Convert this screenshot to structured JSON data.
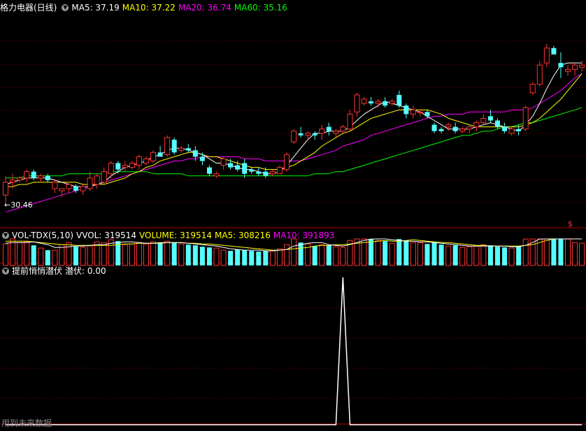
{
  "colors": {
    "background": "#000000",
    "grid": "#8b0000",
    "axis": "#b00000",
    "up": "#ff3232",
    "down": "#54ffff",
    "ma5": "#ffffff",
    "ma10": "#ffff00",
    "ma20": "#ff00ff",
    "ma60": "#00ff00",
    "vol_ma5": "#ffffff",
    "vol_ma10": "#ffff00",
    "signal": "#ffffff"
  },
  "price_panel": {
    "title": "格力电器(日线)",
    "toggle_icon": "chevron-down-icon",
    "legend": [
      {
        "label": "MA5: 37.19",
        "color": "#ffffff"
      },
      {
        "label": "MA10: 37.22",
        "color": "#ffff00"
      },
      {
        "label": "MA20: 36.74",
        "color": "#ff00ff"
      },
      {
        "label": "MA60: 35.16",
        "color": "#00ff00"
      }
    ],
    "low_marker": "30.46",
    "corner_marker": "$"
  },
  "volume_panel": {
    "title": "VOL-TDX(5,10)",
    "toggle_icon": "chevron-down-icon",
    "legend": [
      {
        "label": "VVOL: 319514",
        "color": "#ffffff"
      },
      {
        "label": "VOLUME: 319514",
        "color": "#ffff00"
      },
      {
        "label": "MA5: 308216",
        "color": "#ffff00"
      },
      {
        "label": "MA10: 391893",
        "color": "#ff00ff"
      }
    ]
  },
  "signal_panel": {
    "title": "提前悄悄潜伏",
    "toggle_icon": "chevron-down-icon",
    "legend": [
      {
        "label": "潜伏: 0.00",
        "color": "#ffffff"
      }
    ]
  },
  "footer_note": "用到未来数据",
  "chart_data": [
    {
      "type": "candlestick",
      "ylim": [
        29.5,
        39.5
      ],
      "candles": [
        [
          31.0,
          31.9,
          30.5,
          31.6
        ],
        [
          31.6,
          32.0,
          31.3,
          31.7
        ],
        [
          31.7,
          31.9,
          31.6,
          31.8
        ],
        [
          31.8,
          32.2,
          31.6,
          32.1
        ],
        [
          32.1,
          32.2,
          31.7,
          31.8
        ],
        [
          31.8,
          32.0,
          31.6,
          31.9
        ],
        [
          31.9,
          32.0,
          31.6,
          31.7
        ],
        [
          31.3,
          31.7,
          31.1,
          31.6
        ],
        [
          31.2,
          31.3,
          30.9,
          31.3
        ],
        [
          31.3,
          31.6,
          31.1,
          31.5
        ],
        [
          31.4,
          31.5,
          31.1,
          31.2
        ],
        [
          31.2,
          31.5,
          31.0,
          31.4
        ],
        [
          31.3,
          32.1,
          31.2,
          31.8
        ],
        [
          31.5,
          32.0,
          31.3,
          31.9
        ],
        [
          31.6,
          32.3,
          31.5,
          32.1
        ],
        [
          32.0,
          32.6,
          31.8,
          32.5
        ],
        [
          32.5,
          32.6,
          32.0,
          32.2
        ],
        [
          32.3,
          32.6,
          32.1,
          32.4
        ],
        [
          32.3,
          32.6,
          32.2,
          32.5
        ],
        [
          32.4,
          32.9,
          32.2,
          32.8
        ],
        [
          32.5,
          32.8,
          32.4,
          32.7
        ],
        [
          32.6,
          33.1,
          32.5,
          33.0
        ],
        [
          33.0,
          33.3,
          32.9,
          32.8
        ],
        [
          32.9,
          33.8,
          32.8,
          33.7
        ],
        [
          33.6,
          33.7,
          32.9,
          33.0
        ],
        [
          33.1,
          33.3,
          33.0,
          33.2
        ],
        [
          33.2,
          33.4,
          33.0,
          33.1
        ],
        [
          33.1,
          33.3,
          32.6,
          32.8
        ],
        [
          32.8,
          33.0,
          32.4,
          32.6
        ],
        [
          32.3,
          32.4,
          31.9,
          32.0
        ],
        [
          31.9,
          32.1,
          31.8,
          32.0
        ],
        [
          32.4,
          32.8,
          32.2,
          32.7
        ],
        [
          32.5,
          32.7,
          32.2,
          32.3
        ],
        [
          32.4,
          32.6,
          32.1,
          32.2
        ],
        [
          32.5,
          32.7,
          31.8,
          32.0
        ],
        [
          32.2,
          32.3,
          32.0,
          32.1
        ],
        [
          32.1,
          32.3,
          31.9,
          32.0
        ],
        [
          32.1,
          32.3,
          31.8,
          31.9
        ],
        [
          32.0,
          32.2,
          31.9,
          32.1
        ],
        [
          32.0,
          32.4,
          32.0,
          32.3
        ],
        [
          32.2,
          33.0,
          32.1,
          32.9
        ],
        [
          33.5,
          34.1,
          33.4,
          34.0
        ],
        [
          33.9,
          34.2,
          33.7,
          33.8
        ],
        [
          33.8,
          34.0,
          33.6,
          33.9
        ],
        [
          33.9,
          34.0,
          33.6,
          33.8
        ],
        [
          33.9,
          34.3,
          33.6,
          34.1
        ],
        [
          34.2,
          34.4,
          33.8,
          34.0
        ],
        [
          33.9,
          34.1,
          33.7,
          34.0
        ],
        [
          34.0,
          34.3,
          33.9,
          34.2
        ],
        [
          34.1,
          35.0,
          34.0,
          34.8
        ],
        [
          34.9,
          35.8,
          34.7,
          35.7
        ],
        [
          35.3,
          35.6,
          35.2,
          35.5
        ],
        [
          35.4,
          35.6,
          35.2,
          35.3
        ],
        [
          35.3,
          35.5,
          35.1,
          35.4
        ],
        [
          35.4,
          35.6,
          35.1,
          35.2
        ],
        [
          35.3,
          35.5,
          35.2,
          35.4
        ],
        [
          35.7,
          35.9,
          35.1,
          35.2
        ],
        [
          35.2,
          35.3,
          34.6,
          34.8
        ],
        [
          34.8,
          35.2,
          34.6,
          35.0
        ],
        [
          34.9,
          35.0,
          34.7,
          34.9
        ],
        [
          34.9,
          35.0,
          34.6,
          34.7
        ],
        [
          34.3,
          34.4,
          33.9,
          34.0
        ],
        [
          34.1,
          34.2,
          33.9,
          34.0
        ],
        [
          34.2,
          34.4,
          34.0,
          34.3
        ],
        [
          34.2,
          34.4,
          33.9,
          34.0
        ],
        [
          34.0,
          34.2,
          33.9,
          34.1
        ],
        [
          34.1,
          34.3,
          33.9,
          34.2
        ],
        [
          34.2,
          34.5,
          34.0,
          34.4
        ],
        [
          34.4,
          34.8,
          34.3,
          34.6
        ],
        [
          34.7,
          35.0,
          34.4,
          34.5
        ],
        [
          34.5,
          34.6,
          34.1,
          34.2
        ],
        [
          34.2,
          34.4,
          33.9,
          34.0
        ],
        [
          33.9,
          34.2,
          33.8,
          34.1
        ],
        [
          34.1,
          34.3,
          33.8,
          34.0
        ],
        [
          34.1,
          35.2,
          34.0,
          35.1
        ],
        [
          35.8,
          36.3,
          35.7,
          36.2
        ],
        [
          36.2,
          37.3,
          36.1,
          37.1
        ],
        [
          37.2,
          38.1,
          37.0,
          37.9
        ],
        [
          37.9,
          38.0,
          37.6,
          37.6
        ],
        [
          37.2,
          37.7,
          36.5,
          37.0
        ],
        [
          36.8,
          37.1,
          36.6,
          36.9
        ],
        [
          36.9,
          37.2,
          36.6,
          37.1
        ],
        [
          37.0,
          37.3,
          36.8,
          37.1
        ]
      ],
      "ma5": [
        31.5,
        31.6,
        31.7,
        31.8,
        31.8,
        31.8,
        31.8,
        31.7,
        31.6,
        31.5,
        31.4,
        31.4,
        31.4,
        31.5,
        31.6,
        31.9,
        32.1,
        32.3,
        32.4,
        32.5,
        32.6,
        32.8,
        32.9,
        33.1,
        33.2,
        33.2,
        33.1,
        33.0,
        32.9,
        32.7,
        32.5,
        32.5,
        32.4,
        32.3,
        32.2,
        32.2,
        32.1,
        32.0,
        32.0,
        32.1,
        32.4,
        32.8,
        33.2,
        33.6,
        33.9,
        33.9,
        34.0,
        34.0,
        34.0,
        34.2,
        34.5,
        34.8,
        35.0,
        35.2,
        35.4,
        35.3,
        35.2,
        35.1,
        35.0,
        34.9,
        34.7,
        34.5,
        34.3,
        34.1,
        34.1,
        34.1,
        34.1,
        34.2,
        34.3,
        34.4,
        34.3,
        34.2,
        34.1,
        34.0,
        34.3,
        34.7,
        35.3,
        36.0,
        36.6,
        37.1,
        37.2,
        37.2,
        37.2
      ],
      "ma10": [
        31.4,
        31.4,
        31.5,
        31.5,
        31.6,
        31.6,
        31.6,
        31.6,
        31.6,
        31.6,
        31.6,
        31.5,
        31.5,
        31.5,
        31.5,
        31.6,
        31.7,
        31.8,
        32.0,
        32.1,
        32.3,
        32.4,
        32.6,
        32.7,
        32.8,
        32.9,
        33.0,
        33.0,
        32.9,
        32.8,
        32.8,
        32.7,
        32.6,
        32.5,
        32.4,
        32.3,
        32.3,
        32.2,
        32.2,
        32.2,
        32.3,
        32.4,
        32.6,
        32.8,
        33.0,
        33.3,
        33.5,
        33.7,
        33.9,
        34.0,
        34.2,
        34.4,
        34.6,
        34.7,
        34.8,
        34.9,
        35.0,
        35.0,
        35.0,
        35.0,
        35.0,
        34.9,
        34.8,
        34.6,
        34.5,
        34.4,
        34.3,
        34.2,
        34.2,
        34.2,
        34.2,
        34.2,
        34.2,
        34.2,
        34.3,
        34.4,
        34.6,
        34.9,
        35.2,
        35.5,
        35.9,
        36.3,
        36.7
      ],
      "ma20": [
        30.2,
        30.3,
        30.4,
        30.5,
        30.6,
        30.7,
        30.8,
        30.9,
        31.0,
        31.1,
        31.2,
        31.3,
        31.4,
        31.5,
        31.6,
        31.7,
        31.8,
        31.9,
        32.0,
        32.1,
        32.2,
        32.3,
        32.4,
        32.5,
        32.6,
        32.6,
        32.7,
        32.7,
        32.8,
        32.8,
        32.8,
        32.8,
        32.8,
        32.8,
        32.7,
        32.7,
        32.7,
        32.6,
        32.6,
        32.6,
        32.6,
        32.6,
        32.6,
        32.7,
        32.8,
        32.9,
        33.0,
        33.1,
        33.3,
        33.4,
        33.5,
        33.6,
        33.8,
        33.9,
        34.0,
        34.1,
        34.2,
        34.3,
        34.4,
        34.5,
        34.6,
        34.7,
        34.7,
        34.8,
        34.8,
        34.8,
        34.9,
        34.9,
        34.9,
        34.9,
        34.9,
        34.9,
        35.0,
        35.0,
        35.0,
        35.1,
        35.3,
        35.5,
        35.7,
        35.9,
        36.2,
        36.5,
        36.7
      ],
      "ma60": [
        31.8,
        31.8,
        31.8,
        31.9,
        31.9,
        31.9,
        31.9,
        31.9,
        31.9,
        32.0,
        32.0,
        32.0,
        32.0,
        32.0,
        32.0,
        32.1,
        32.1,
        32.1,
        32.1,
        32.1,
        32.1,
        32.0,
        32.0,
        32.0,
        32.0,
        32.0,
        31.9,
        31.9,
        31.9,
        31.9,
        31.9,
        31.9,
        31.9,
        31.9,
        31.9,
        31.9,
        31.9,
        31.9,
        31.9,
        31.9,
        31.9,
        31.9,
        31.9,
        31.9,
        32.0,
        32.0,
        32.0,
        32.1,
        32.1,
        32.2,
        32.3,
        32.4,
        32.5,
        32.6,
        32.7,
        32.8,
        32.9,
        33.0,
        33.1,
        33.2,
        33.3,
        33.4,
        33.5,
        33.6,
        33.7,
        33.8,
        33.8,
        33.9,
        34.0,
        34.0,
        34.1,
        34.2,
        34.2,
        34.3,
        34.4,
        34.4,
        34.5,
        34.6,
        34.7,
        34.8,
        34.9,
        35.0,
        35.1
      ]
    },
    {
      "type": "bar",
      "ylim": [
        0,
        650000
      ],
      "values": [
        310000,
        460000,
        330000,
        340000,
        290000,
        250000,
        220000,
        220000,
        300000,
        330000,
        270000,
        260000,
        280000,
        340000,
        330000,
        370000,
        350000,
        300000,
        310000,
        330000,
        310000,
        340000,
        330000,
        350000,
        330000,
        310000,
        300000,
        290000,
        270000,
        260000,
        250000,
        220000,
        210000,
        230000,
        220000,
        210000,
        200000,
        210000,
        220000,
        240000,
        300000,
        420000,
        330000,
        310000,
        280000,
        300000,
        290000,
        270000,
        260000,
        360000,
        480000,
        420000,
        390000,
        360000,
        350000,
        320000,
        380000,
        360000,
        330000,
        330000,
        310000,
        340000,
        300000,
        280000,
        290000,
        260000,
        270000,
        280000,
        300000,
        290000,
        270000,
        260000,
        250000,
        280000,
        380000,
        460000,
        560000,
        600000,
        480000,
        420000,
        380000,
        330000,
        320000
      ],
      "ma5": [
        320000,
        330000,
        330000,
        330000,
        340000,
        320000,
        300000,
        260000,
        260000,
        270000,
        280000,
        280000,
        290000,
        300000,
        300000,
        320000,
        330000,
        340000,
        340000,
        330000,
        320000,
        320000,
        320000,
        330000,
        330000,
        330000,
        320000,
        310000,
        300000,
        290000,
        280000,
        260000,
        240000,
        230000,
        220000,
        220000,
        220000,
        210000,
        210000,
        220000,
        230000,
        280000,
        300000,
        320000,
        330000,
        330000,
        300000,
        290000,
        280000,
        300000,
        330000,
        360000,
        380000,
        400000,
        400000,
        370000,
        360000,
        350000,
        350000,
        340000,
        340000,
        330000,
        320000,
        310000,
        300000,
        290000,
        280000,
        280000,
        280000,
        280000,
        280000,
        280000,
        270000,
        270000,
        290000,
        330000,
        380000,
        460000,
        500000,
        500000,
        490000,
        450000,
        390000
      ],
      "ma10": [
        350000,
        350000,
        350000,
        350000,
        340000,
        330000,
        320000,
        310000,
        300000,
        300000,
        290000,
        290000,
        290000,
        290000,
        290000,
        290000,
        300000,
        310000,
        310000,
        320000,
        320000,
        320000,
        330000,
        330000,
        330000,
        330000,
        320000,
        320000,
        310000,
        310000,
        300000,
        290000,
        280000,
        270000,
        260000,
        250000,
        240000,
        230000,
        220000,
        220000,
        230000,
        240000,
        250000,
        260000,
        280000,
        290000,
        290000,
        300000,
        300000,
        310000,
        320000,
        330000,
        340000,
        350000,
        360000,
        350000,
        350000,
        360000,
        370000,
        360000,
        350000,
        340000,
        330000,
        330000,
        320000,
        310000,
        300000,
        290000,
        290000,
        280000,
        280000,
        280000,
        280000,
        280000,
        290000,
        300000,
        330000,
        360000,
        390000,
        400000,
        410000,
        410000,
        400000
      ]
    },
    {
      "type": "line",
      "x": [
        0,
        47,
        48,
        49,
        82
      ],
      "y": [
        0,
        0,
        1,
        0,
        0
      ],
      "ylim": [
        0,
        1
      ]
    }
  ]
}
